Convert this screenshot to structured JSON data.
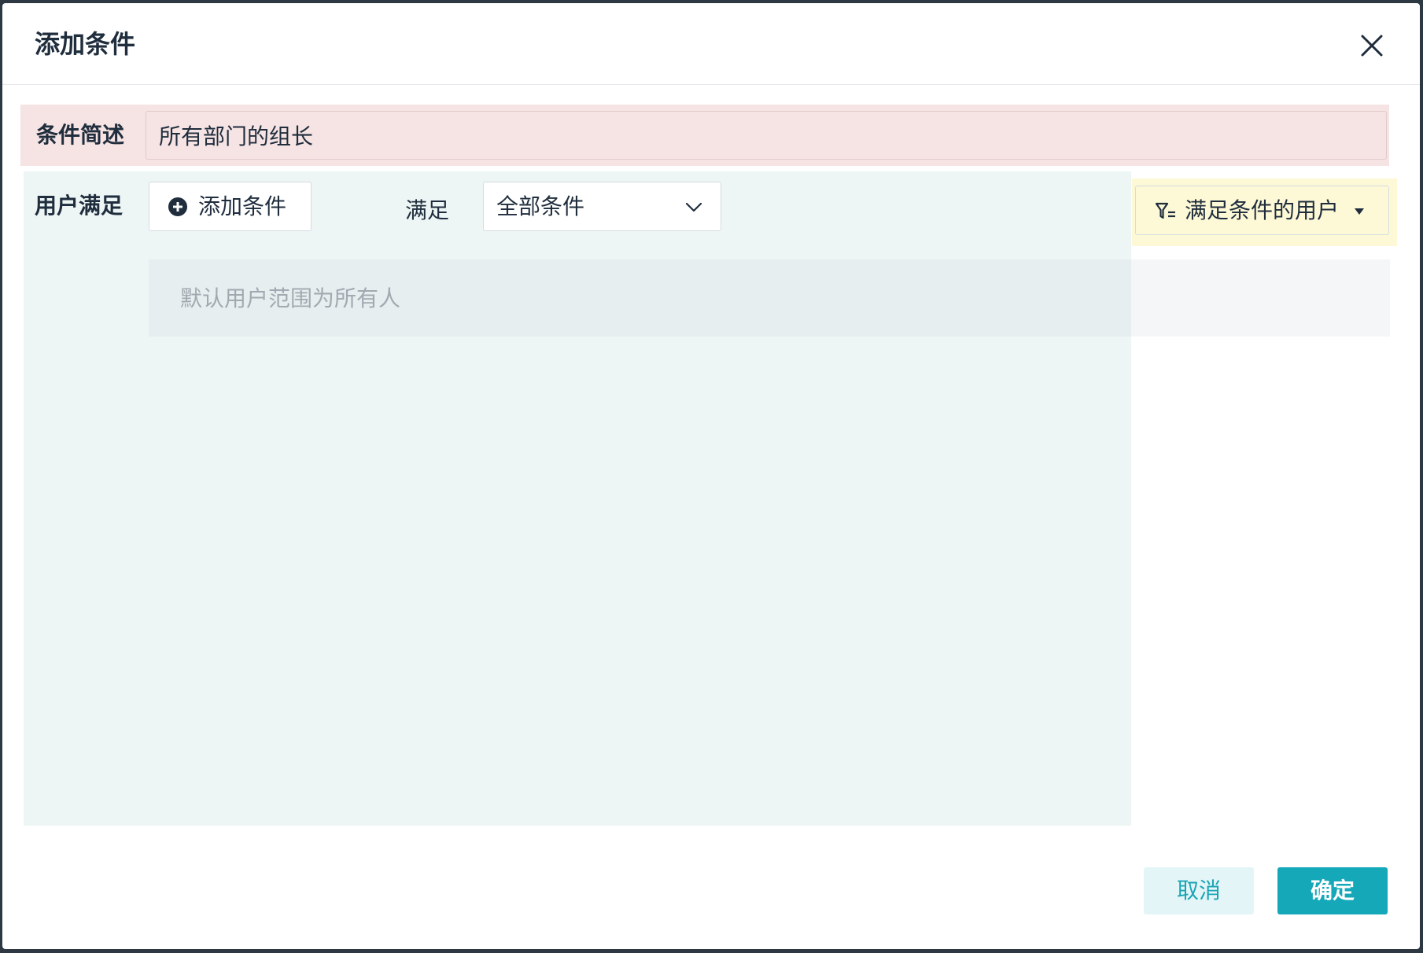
{
  "dialog": {
    "title": "添加条件",
    "close_icon": "close-icon"
  },
  "description": {
    "label": "条件简述",
    "value": "所有部门的组长"
  },
  "conditions": {
    "label": "用户满足",
    "add_button_label": "添加条件",
    "add_icon": "plus-circle-icon",
    "satisfy_label": "满足",
    "match_mode": "全部条件",
    "empty_hint": "默认用户范围为所有人"
  },
  "users_filter": {
    "label": "满足条件的用户",
    "icon": "filter-icon"
  },
  "footer": {
    "cancel_label": "取消",
    "confirm_label": "确定"
  },
  "colors": {
    "accent": "#14a8b9",
    "title_text": "#1f2d3d",
    "hint_text": "#a2a9b0"
  }
}
